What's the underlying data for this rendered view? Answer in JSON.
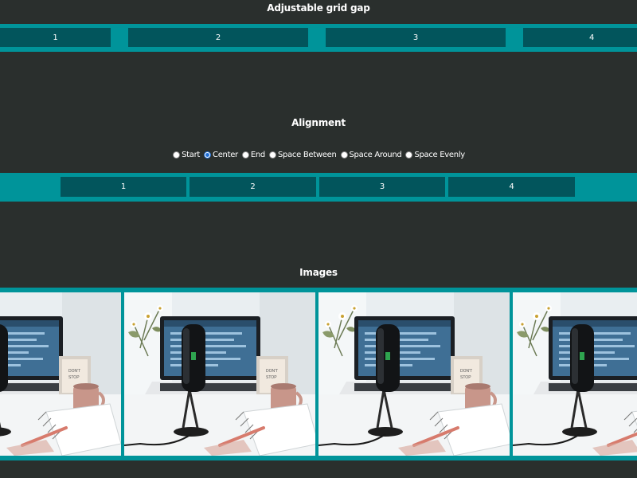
{
  "sections": {
    "grid_gap": {
      "title": "Adjustable grid gap",
      "items": [
        "1",
        "2",
        "3",
        "4"
      ]
    },
    "alignment": {
      "title": "Alignment",
      "options": [
        "Start",
        "Center",
        "End",
        "Space Between",
        "Space Around",
        "Space Evenly"
      ],
      "selected": "Center",
      "items": [
        "1",
        "2",
        "3",
        "4"
      ]
    },
    "images": {
      "title": "Images",
      "photos": [
        "desk-microphone-photo",
        "desk-microphone-photo",
        "desk-microphone-photo",
        "desk-microphone-photo"
      ]
    }
  },
  "colors": {
    "background": "#2a2f2d",
    "band": "#00949a",
    "cell": "#02555c",
    "text": "#ffffff",
    "radio_accent": "#1f6fd6"
  }
}
